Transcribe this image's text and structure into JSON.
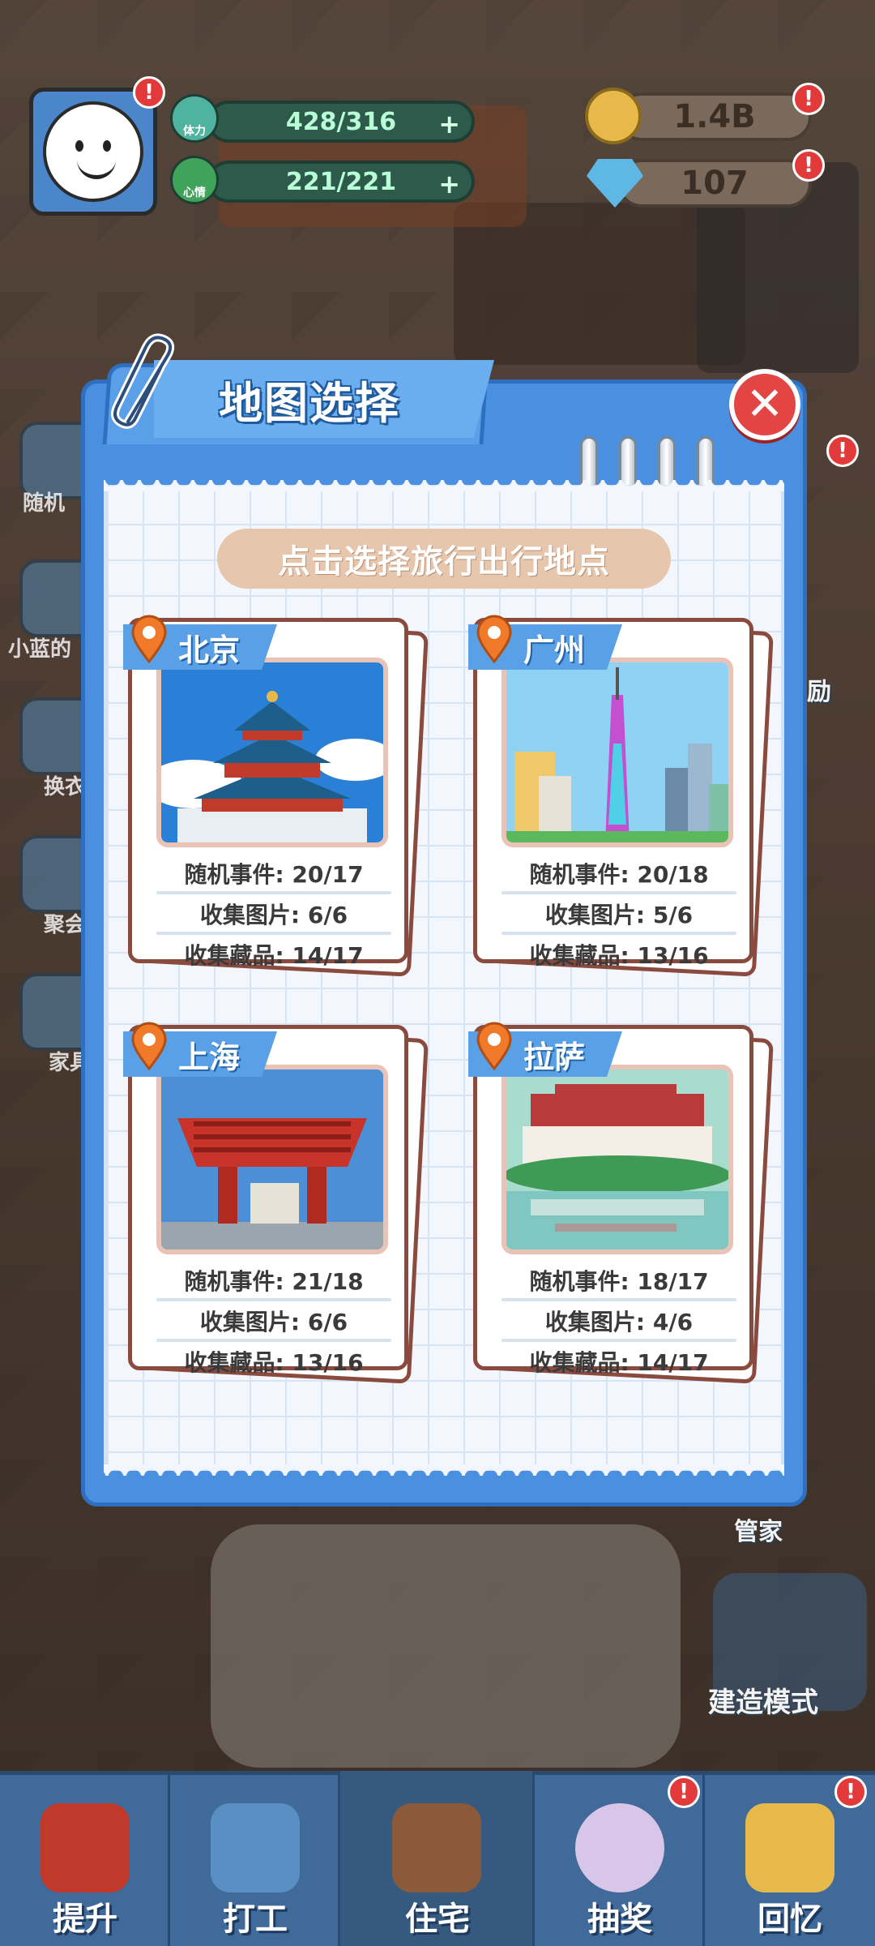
{
  "hud": {
    "stamina_label": "体力",
    "stamina_value": "428/316",
    "mood_label": "心情",
    "mood_value": "221/221",
    "coins": "1.4B",
    "gems": "107",
    "alert_mark": "!"
  },
  "side_menu": [
    "随机",
    "小蓝的",
    "换衣",
    "聚会",
    "家具"
  ],
  "side_right": {
    "reward_partial": "励",
    "butler": "管家",
    "build_mode": "建造模式"
  },
  "modal": {
    "title": "地图选择",
    "close_glyph": "✕",
    "subtitle": "点击选择旅行出行地点"
  },
  "cities": [
    {
      "name": "北京",
      "events_label": "随机事件:",
      "events": "20/17",
      "photos_label": "收集图片:",
      "photos": "6/6",
      "items_label": "收集藏品:",
      "items": "14/17"
    },
    {
      "name": "广州",
      "events_label": "随机事件:",
      "events": "20/18",
      "photos_label": "收集图片:",
      "photos": "5/6",
      "items_label": "收集藏品:",
      "items": "13/16"
    },
    {
      "name": "上海",
      "events_label": "随机事件:",
      "events": "21/18",
      "photos_label": "收集图片:",
      "photos": "6/6",
      "items_label": "收集藏品:",
      "items": "13/16"
    },
    {
      "name": "拉萨",
      "events_label": "随机事件:",
      "events": "18/17",
      "photos_label": "收集图片:",
      "photos": "4/6",
      "items_label": "收集藏品:",
      "items": "14/17"
    }
  ],
  "bottom_nav": [
    "提升",
    "打工",
    "住宅",
    "抽奖",
    "回忆"
  ],
  "colors": {
    "modal_blue": "#4a8fe0",
    "card_border": "#8a4a3e",
    "pin_orange": "#f07a2a",
    "close_red": "#e34545"
  }
}
